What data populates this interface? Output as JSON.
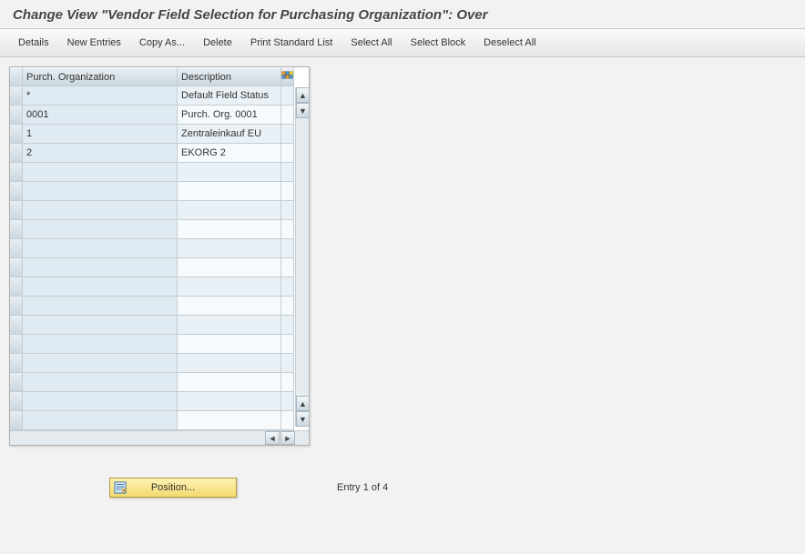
{
  "header": {
    "title": "Change View \"Vendor Field Selection for Purchasing Organization\": Over"
  },
  "toolbar": {
    "details": "Details",
    "new_entries": "New Entries",
    "copy_as": "Copy As...",
    "delete": "Delete",
    "print_std_list": "Print Standard List",
    "select_all": "Select All",
    "select_block": "Select Block",
    "deselect_all": "Deselect All"
  },
  "table": {
    "columns": {
      "org": "Purch. Organization",
      "desc": "Description"
    },
    "rows": [
      {
        "org": "*",
        "desc": "Default Field Status"
      },
      {
        "org": "0001",
        "desc": "Purch. Org. 0001"
      },
      {
        "org": "1",
        "desc": "Zentraleinkauf EU"
      },
      {
        "org": "2",
        "desc": "EKORG 2"
      }
    ]
  },
  "footer": {
    "position_label": "Position...",
    "entry_text": "Entry 1 of 4"
  }
}
